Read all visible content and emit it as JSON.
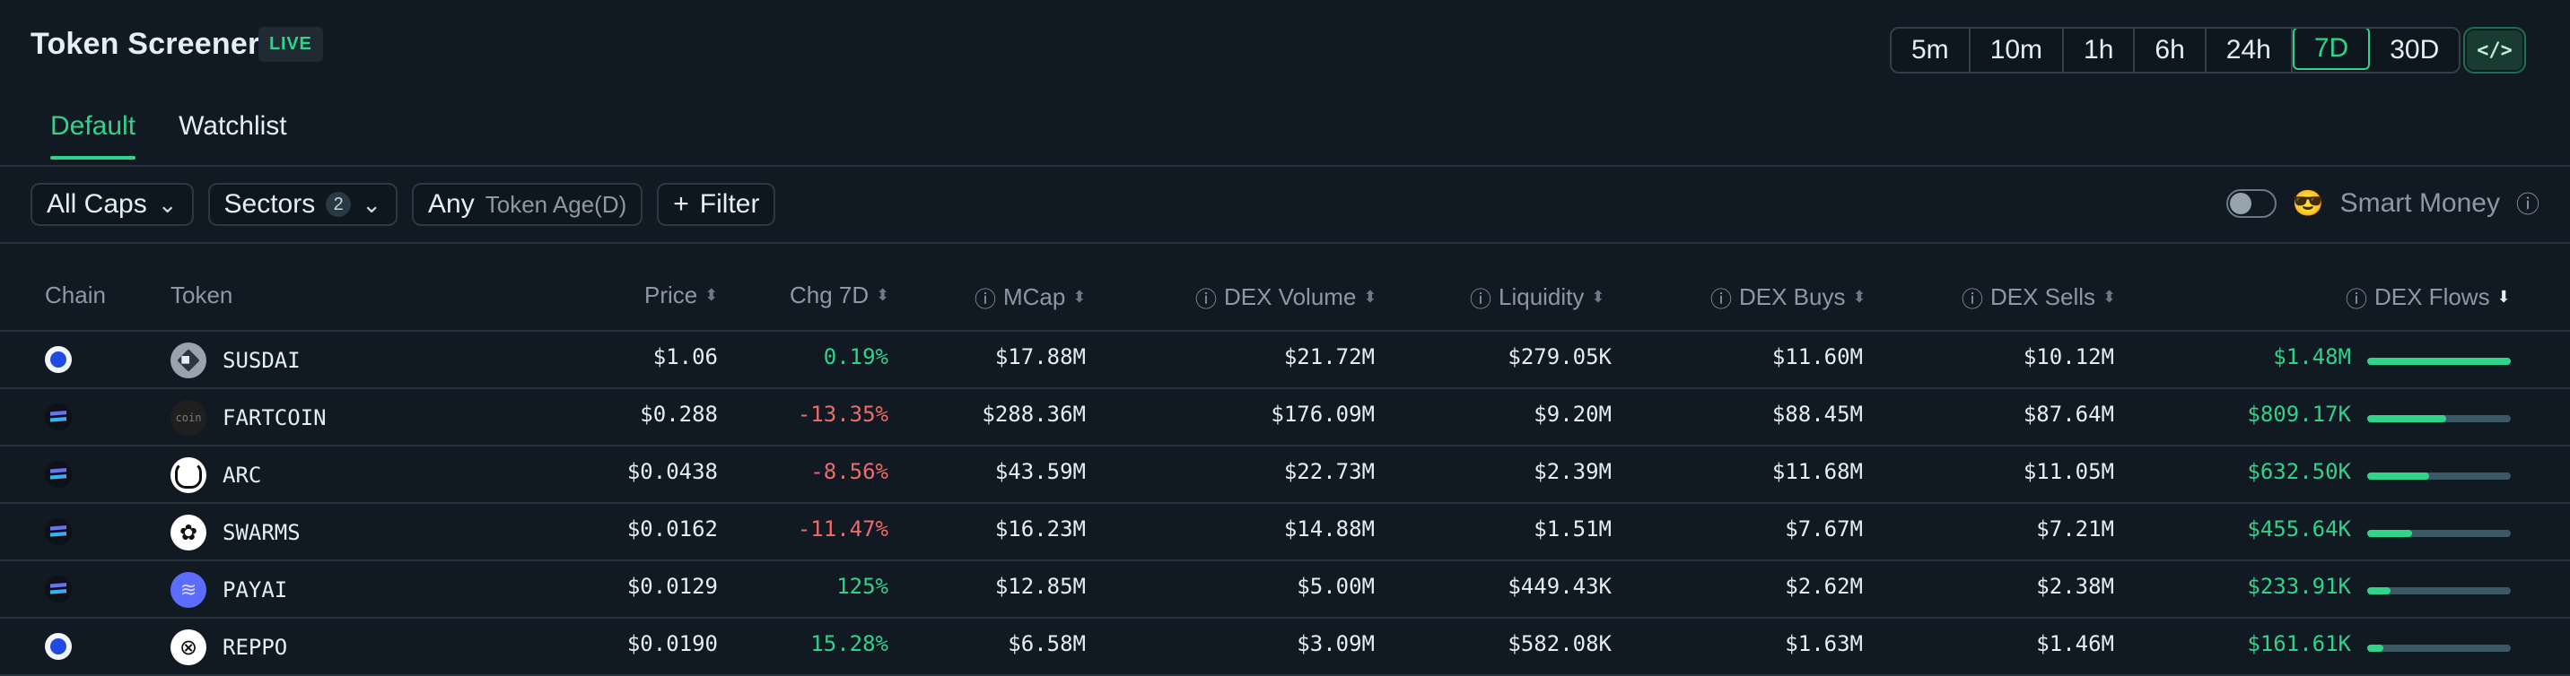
{
  "colors": {
    "green": "#2fd38a",
    "red": "#f06a6a",
    "bg": "#111a22"
  },
  "header": {
    "title": "Token Screener",
    "live": "LIVE",
    "time_ranges": [
      "5m",
      "10m",
      "1h",
      "6h",
      "24h",
      "7D",
      "30D"
    ],
    "active_range": "7D",
    "code_button_label": "</>"
  },
  "tabs": [
    {
      "label": "Default",
      "active": true
    },
    {
      "label": "Watchlist",
      "active": false
    }
  ],
  "filters": {
    "caps": "All Caps",
    "sectors": "Sectors",
    "sectors_count": "2",
    "age_any": "Any",
    "age_label": "Token Age(D)",
    "filter_label": "Filter"
  },
  "smart_money": {
    "label": "Smart Money"
  },
  "table": {
    "columns": [
      "Chain",
      "Token",
      "Price",
      "Chg 7D",
      "MCap",
      "DEX Volume",
      "Liquidity",
      "DEX Buys",
      "DEX Sells",
      "DEX Flows"
    ],
    "rows": [
      {
        "chain": "base",
        "chain_icon": "base-chain-icon",
        "token": "SUSDAI",
        "icon": "s",
        "icon_glyph": "◆",
        "price": "$1.06",
        "chg": "0.19%",
        "chg_dir": "up",
        "mcap": "$17.88M",
        "dex_volume": "$21.72M",
        "liquidity": "$279.05K",
        "dex_buys": "$11.60M",
        "dex_sells": "$10.12M",
        "dex_flows": "$1.48M",
        "flow_fill": 1.0
      },
      {
        "chain": "sol",
        "chain_icon": "solana-chain-icon",
        "token": "FARTCOIN",
        "icon": "f",
        "icon_glyph": "coin",
        "price": "$0.288",
        "chg": "-13.35%",
        "chg_dir": "down",
        "mcap": "$288.36M",
        "dex_volume": "$176.09M",
        "liquidity": "$9.20M",
        "dex_buys": "$88.45M",
        "dex_sells": "$87.64M",
        "dex_flows": "$809.17K",
        "flow_fill": 0.55
      },
      {
        "chain": "sol",
        "chain_icon": "solana-chain-icon",
        "token": "ARC",
        "icon": "a",
        "icon_glyph": "",
        "price": "$0.0438",
        "chg": "-8.56%",
        "chg_dir": "down",
        "mcap": "$43.59M",
        "dex_volume": "$22.73M",
        "liquidity": "$2.39M",
        "dex_buys": "$11.68M",
        "dex_sells": "$11.05M",
        "dex_flows": "$632.50K",
        "flow_fill": 0.43
      },
      {
        "chain": "sol",
        "chain_icon": "solana-chain-icon",
        "token": "SWARMS",
        "icon": "w",
        "icon_glyph": "✿",
        "price": "$0.0162",
        "chg": "-11.47%",
        "chg_dir": "down",
        "mcap": "$16.23M",
        "dex_volume": "$14.88M",
        "liquidity": "$1.51M",
        "dex_buys": "$7.67M",
        "dex_sells": "$7.21M",
        "dex_flows": "$455.64K",
        "flow_fill": 0.31
      },
      {
        "chain": "sol",
        "chain_icon": "solana-chain-icon",
        "token": "PAYAI",
        "icon": "p",
        "icon_glyph": "≋",
        "price": "$0.0129",
        "chg": "125%",
        "chg_dir": "up",
        "mcap": "$12.85M",
        "dex_volume": "$5.00M",
        "liquidity": "$449.43K",
        "dex_buys": "$2.62M",
        "dex_sells": "$2.38M",
        "dex_flows": "$233.91K",
        "flow_fill": 0.16
      },
      {
        "chain": "base",
        "chain_icon": "base-chain-icon",
        "token": "REPPO",
        "icon": "r",
        "icon_glyph": "⊗",
        "price": "$0.0190",
        "chg": "15.28%",
        "chg_dir": "up",
        "mcap": "$6.58M",
        "dex_volume": "$3.09M",
        "liquidity": "$582.08K",
        "dex_buys": "$1.63M",
        "dex_sells": "$1.46M",
        "dex_flows": "$161.61K",
        "flow_fill": 0.11
      }
    ]
  }
}
